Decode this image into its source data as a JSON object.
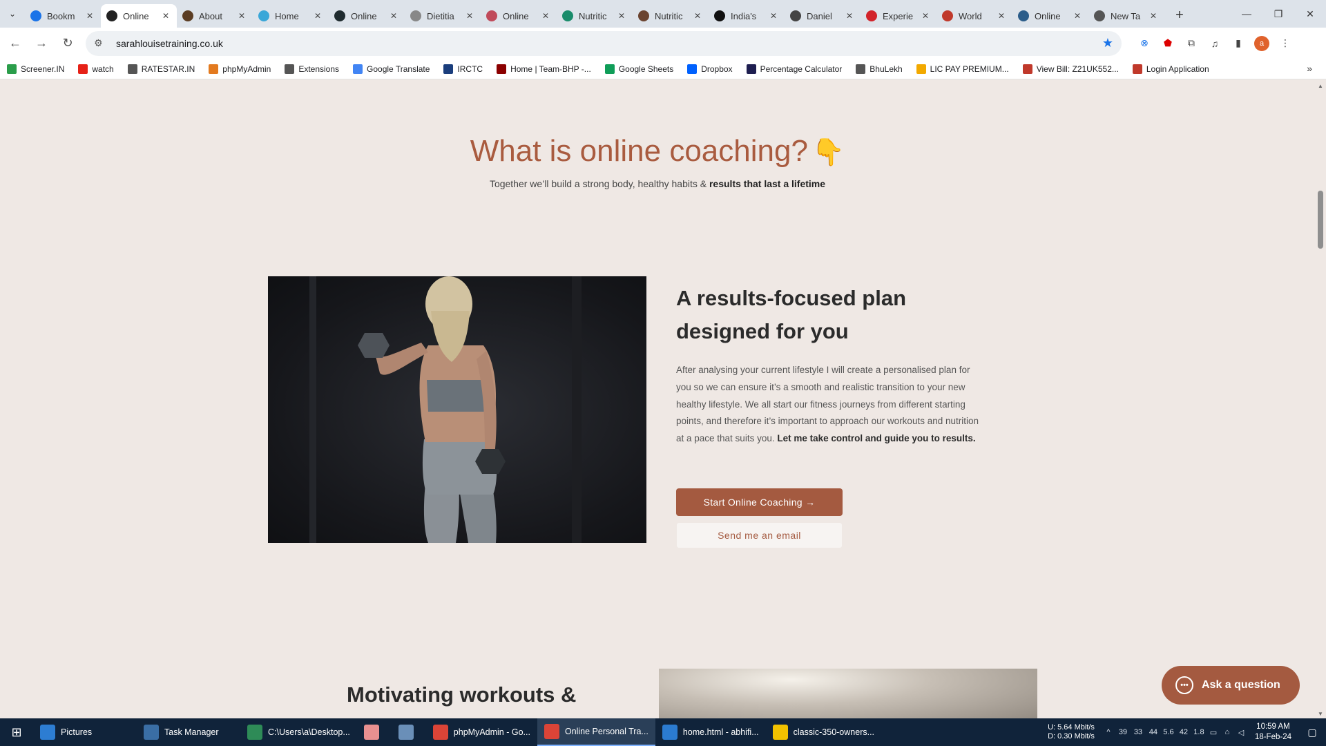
{
  "browser": {
    "tabs": [
      {
        "title": "Bookm",
        "color": "#1a73e8"
      },
      {
        "title": "Online",
        "color": "#222222",
        "active": true
      },
      {
        "title": "About",
        "color": "#5b3d23"
      },
      {
        "title": "Home",
        "color": "#3aa7d8"
      },
      {
        "title": "Online",
        "color": "#1f2b2f"
      },
      {
        "title": "Dietitia",
        "color": "#888888"
      },
      {
        "title": "Online",
        "color": "#c04a5a"
      },
      {
        "title": "Nutritic",
        "color": "#1a8c6b"
      },
      {
        "title": "Nutritic",
        "color": "#6b4430"
      },
      {
        "title": "India's",
        "color": "#111111"
      },
      {
        "title": "Daniel",
        "color": "#444444"
      },
      {
        "title": "Experie",
        "color": "#d2232a"
      },
      {
        "title": "World",
        "color": "#c0392b"
      },
      {
        "title": "Online",
        "color": "#2c5d8a"
      },
      {
        "title": "New Ta",
        "color": "#555555"
      }
    ],
    "url": "sarahlouisetraining.co.uk",
    "bookmarks": [
      {
        "label": "Screener.IN",
        "color": "#2a9d4a"
      },
      {
        "label": "watch",
        "color": "#e62117"
      },
      {
        "label": "RATESTAR.IN",
        "color": "#555555"
      },
      {
        "label": "phpMyAdmin",
        "color": "#e37a1f"
      },
      {
        "label": "Extensions",
        "color": "#555555"
      },
      {
        "label": "Google Translate",
        "color": "#4285f4"
      },
      {
        "label": "IRCTC",
        "color": "#1a3d7c"
      },
      {
        "label": "Home | Team-BHP -...",
        "color": "#8b0000"
      },
      {
        "label": "Google Sheets",
        "color": "#0f9d58"
      },
      {
        "label": "Dropbox",
        "color": "#0061fe"
      },
      {
        "label": "Percentage Calculator",
        "color": "#1e1e50"
      },
      {
        "label": "BhuLekh",
        "color": "#555555"
      },
      {
        "label": "LIC PAY PREMIUM...",
        "color": "#f2a900"
      },
      {
        "label": "View Bill: Z21UK552...",
        "color": "#c0392b"
      },
      {
        "label": "Login Application",
        "color": "#c0392b"
      }
    ]
  },
  "page": {
    "hero_title": "What is online coaching?",
    "hero_sub_plain": "Together we’ll build a strong body, healthy habits & ",
    "hero_sub_bold": "results that last a lifetime",
    "plan_title": "A results-focused plan designed for you",
    "plan_body_plain": "After analysing your current lifestyle I will create a personalised plan for you so we can ensure it’s a smooth and realistic transition to your new healthy lifestyle. We all start our fitness journeys from different starting points, and therefore it’s important to approach our workouts and nutrition at a pace that suits you. ",
    "plan_body_bold": "Let me take control and guide you to results.",
    "start_button": "Start Online Coaching →",
    "email_button": "Send me an email",
    "section2_title": "Motivating workouts &",
    "ask_button": "Ask a question"
  },
  "taskbar": {
    "items": [
      {
        "label": "Pictures",
        "color": "#2d7dd2"
      },
      {
        "label": "Task Manager",
        "color": "#3a6ea5"
      },
      {
        "label": "C:\\Users\\a\\Desktop...",
        "color": "#2e8b57"
      },
      {
        "label": "",
        "color": "#e89090"
      },
      {
        "label": "",
        "color": "#6a8fb8"
      },
      {
        "label": "phpMyAdmin - Go...",
        "color": "#db4437"
      },
      {
        "label": "Online Personal Tra...",
        "color": "#db4437",
        "active": true
      },
      {
        "label": "home.html - abhifi...",
        "color": "#2b7bd0"
      },
      {
        "label": "classic-350-owners...",
        "color": "#f2c200"
      }
    ],
    "net_up": "U:   5.64 Mbit/s",
    "net_down": "D:   0.30 Mbit/s",
    "tray_numbers": [
      "39",
      "33",
      "44",
      "5.6",
      "42",
      "1.8"
    ],
    "time": "10:59 AM",
    "date": "18-Feb-24"
  }
}
